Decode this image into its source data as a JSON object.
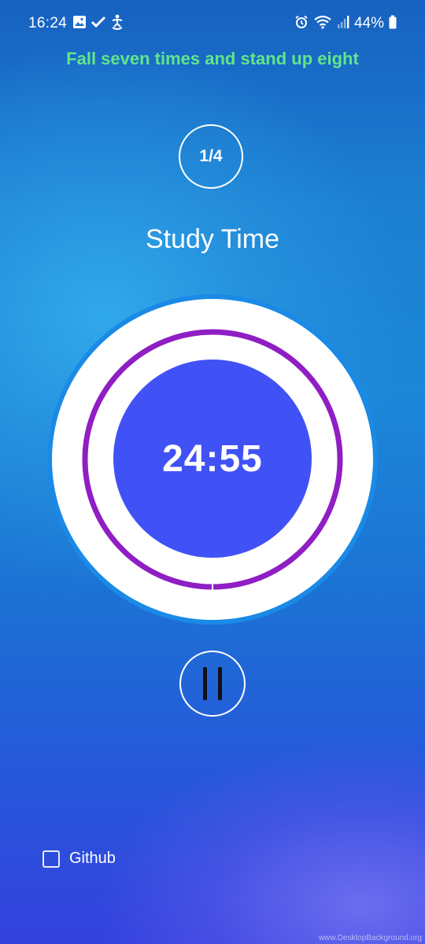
{
  "status_bar": {
    "time": "16:24",
    "left_icons": [
      "image-icon",
      "check-icon",
      "accessibility-icon"
    ],
    "right_icons": [
      "alarm-icon",
      "wifi-icon",
      "signal-icon",
      "battery-icon"
    ],
    "battery_percent": "44%"
  },
  "quote": "Fall seven times and stand up eight",
  "round": {
    "label": "1/4"
  },
  "session": {
    "title": "Study Time",
    "remaining": "24:55",
    "progress": 0.003
  },
  "controls": {
    "pause_icon": "pause-icon"
  },
  "options": {
    "github_label": "Github",
    "github_checked": false
  },
  "watermark": "www.DesktopBackground.org",
  "colors": {
    "quote": "#62e58a",
    "timer_core": "#4052f5",
    "progress_ring": "#8f1ec4",
    "dial_outer": "#ffffff",
    "dial_rim": "#1a8ae6"
  }
}
